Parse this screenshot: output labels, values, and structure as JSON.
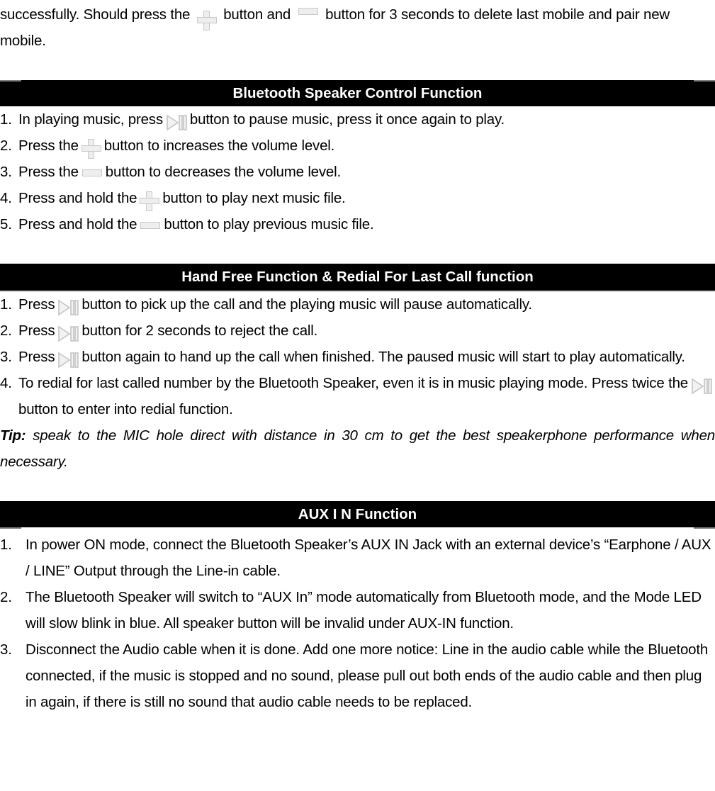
{
  "document": {
    "intro": {
      "before_plus": "successfully. Should press the",
      "between": "button and",
      "after_minus": "button for 3 seconds to delete last mobile and pair new mobile."
    },
    "sections": [
      {
        "id": "bluetooth-speaker-control",
        "heading": "Bluetooth Speaker Control Function",
        "items": [
          {
            "num": "1.",
            "pre": "In playing music, press",
            "icon": "play-pause-icon",
            "post": "button to pause music, press it once again to play."
          },
          {
            "num": "2.",
            "pre": "Press the",
            "icon": "plus-icon",
            "post": "button to increases the volume level."
          },
          {
            "num": "3.",
            "pre": "Press the",
            "icon": "minus-icon",
            "post": "button to decreases the volume level."
          },
          {
            "num": "4.",
            "pre": "Press and hold the",
            "icon": "plus-icon",
            "post": "button to play next music file."
          },
          {
            "num": "5.",
            "pre": "Press and hold the",
            "icon": "minus-icon",
            "post": "button to play previous music file."
          }
        ]
      },
      {
        "id": "hand-free-redial",
        "heading": "Hand Free Function & Redial For Last Call function",
        "items": [
          {
            "num": "1.",
            "pre": "Press",
            "icon": "play-pause-icon",
            "post": "button to pick up the call and the playing music will pause automatically."
          },
          {
            "num": "2.",
            "pre": "Press",
            "icon": "play-pause-icon",
            "post": "button for 2 seconds to reject the call."
          },
          {
            "num": "3.",
            "pre": "Press",
            "icon": "play-pause-icon",
            "post": "button again to hand up the call when finished. The paused music will start to play automatically."
          },
          {
            "num": "4.",
            "pre": "To redial for last called number by the Bluetooth Speaker, even it is in music playing mode. Press twice the",
            "icon": "play-pause-icon",
            "post": "button to enter into redial function."
          }
        ],
        "tip_label": "Tip:",
        "tip_text": "speak to the MIC hole direct with distance in 30 cm to get the best speakerphone performance when necessary."
      },
      {
        "id": "aux-in",
        "heading": "AUX I N Function",
        "items": [
          {
            "num": "1.",
            "text": "In power ON mode, connect the Bluetooth Speaker’s AUX IN Jack with an external device’s “Earphone / AUX / LINE” Output through the Line-in cable."
          },
          {
            "num": "2.",
            "text": "The Bluetooth Speaker will switch to “AUX In” mode automatically from Bluetooth mode, and the Mode LED will slow blink in blue. All speaker button will be invalid under AUX-IN function."
          },
          {
            "num": "3.",
            "text": "Disconnect the Audio cable when it is done. Add one more notice: Line in the audio cable while the Bluetooth connected, if the music is stopped and no sound, please pull out both ends of the audio cable and then plug in again, if there is still no sound that audio cable needs to be replaced."
          }
        ]
      }
    ],
    "colors": {
      "band_background": "#000000",
      "band_text": "#ffffff",
      "body_text": "#000000",
      "icon_fill": "#eeeeee",
      "icon_stroke": "#c9c9c9",
      "rule": "#4a4a4a",
      "edge_line": "#808080"
    }
  }
}
